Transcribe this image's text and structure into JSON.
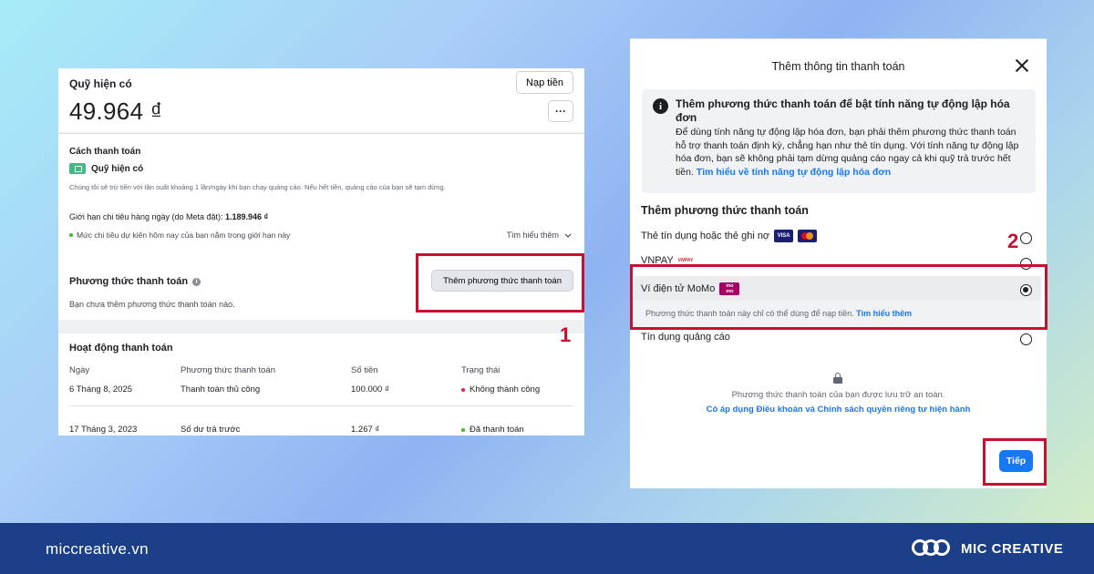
{
  "left": {
    "balance": {
      "title": "Quỹ hiện có",
      "amount": "49.964 ₫",
      "topup_label": "Nạp tiền",
      "more_label": "···"
    },
    "method": {
      "title": "Cách thanh toán",
      "fund_label": "Quỹ hiện có",
      "fund_note": "Chúng tôi sẽ trừ tiền với tần suất khoảng 1 lần/ngày khi bạn chạy quảng cáo. Nếu hết tiền, quảng cáo của bạn sẽ tạm dừng.",
      "limit_label": "Giới hạn chi tiêu hàng ngày (do Meta đặt):",
      "limit_value": "1.189.946 ₫",
      "limit_note": "Mức chi tiêu dự kiến hôm nay của bạn nằm trong giới hạn này",
      "learn_more": "Tìm hiểu thêm"
    },
    "payment_methods": {
      "title": "Phương thức thanh toán",
      "add_button": "Thêm phương thức thanh toán",
      "empty_note": "Bạn chưa thêm phương thức thanh toán nào."
    },
    "activity": {
      "title": "Hoạt động thanh toán",
      "headers": [
        "Ngày",
        "Phương thức thanh toán",
        "Số tiền",
        "Trạng thái"
      ],
      "rows": [
        {
          "date": "6 Tháng 8, 2025",
          "method": "Thanh toán thủ công",
          "amount": "100.000 ₫",
          "status": "Không thành công",
          "status_color": "#e41e3f"
        },
        {
          "date": "17 Tháng 3, 2023",
          "method": "Số dư trả trước",
          "amount": "1.267 ₫",
          "status": "Đã thanh toán",
          "status_color": "#42b72a"
        }
      ]
    }
  },
  "steps": {
    "one": "1",
    "two": "2"
  },
  "modal": {
    "title": "Thêm thông tin thanh toán",
    "info_title": "Thêm phương thức thanh toán để bật tính năng tự động lập hóa đơn",
    "info_body": "Để dùng tính năng tự động lập hóa đơn, bạn phải thêm phương thức thanh toán hỗ trợ thanh toán định kỳ, chẳng hạn như thẻ tín dụng. Với tính năng tự động lập hóa đơn, bạn sẽ không phải tạm dừng quảng cáo ngay cả khi quỹ trả trước hết tiền.",
    "info_link": "Tìm hiểu về tính năng tự động lập hóa đơn",
    "section_title": "Thêm phương thức thanh toán",
    "options": [
      {
        "label": "Thẻ tín dụng hoặc thẻ ghi nợ",
        "selected": false
      },
      {
        "label": "VNPAY",
        "selected": false
      },
      {
        "label": "Ví điện tử MoMo",
        "selected": true
      },
      {
        "label": "Tín dụng quảng cáo",
        "selected": false
      }
    ],
    "visa_label": "VISA",
    "vnpay_logo": "VNPAY",
    "momo_logo_top": "mo",
    "momo_logo_bottom": "mo",
    "momo_note": "Phương thức thanh toán này chỉ có thể dùng để nạp tiền.",
    "momo_link": "Tìm hiểu thêm",
    "safe_note": "Phương thức thanh toán của bạn được lưu trữ an toàn.",
    "terms_link": "Có áp dụng Điều khoản và Chính sách quyền riêng tư hiện hành",
    "next_button": "Tiếp"
  },
  "footer": {
    "site": "miccreative.vn",
    "brand": "MIC CREATIVE"
  },
  "colors": {
    "accent": "#1877f2",
    "highlight": "#c8102e",
    "footer_bg": "#1a3f86"
  }
}
